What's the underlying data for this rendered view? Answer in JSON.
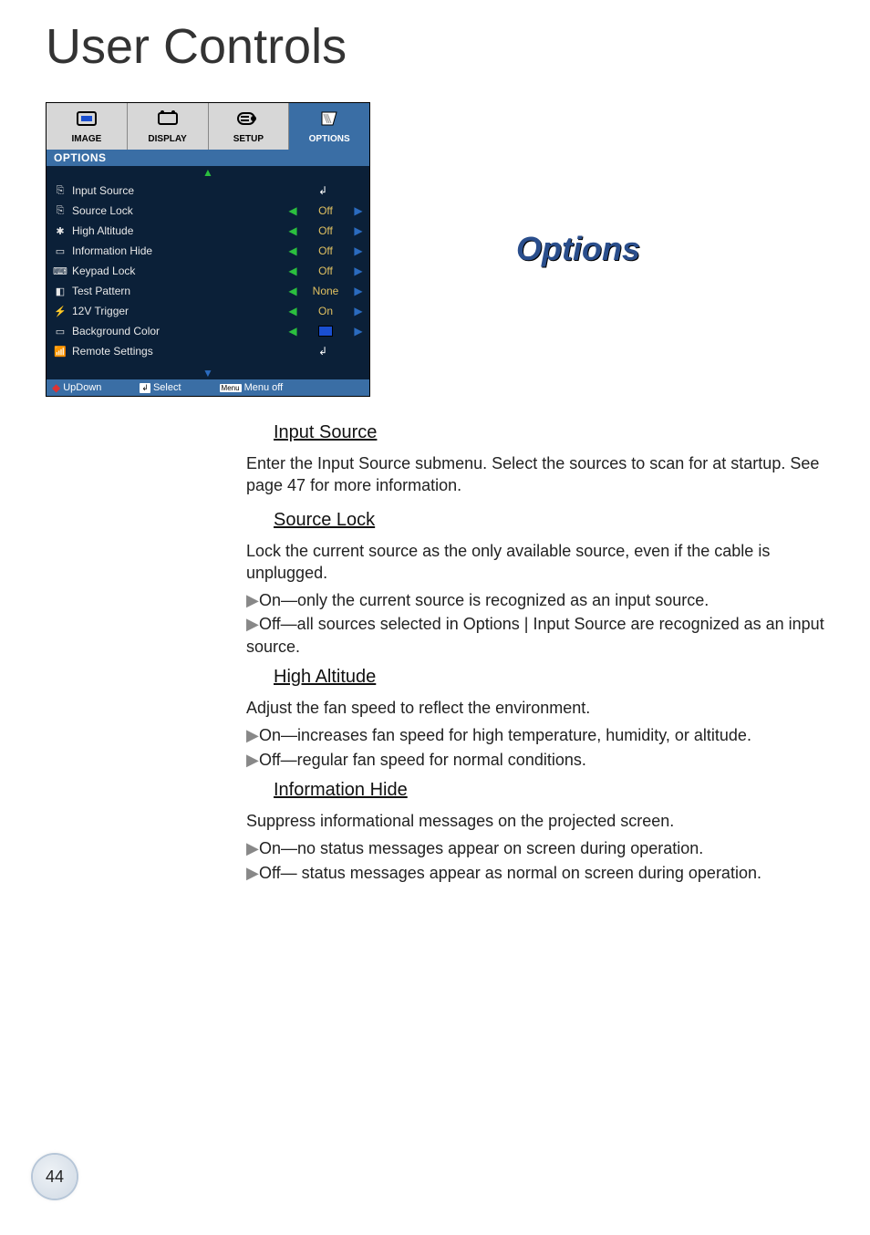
{
  "page_title": "User Controls",
  "section_heading": "Options",
  "osd": {
    "tabs": [
      {
        "label": "IMAGE"
      },
      {
        "label": "DISPLAY"
      },
      {
        "label": "SETUP"
      },
      {
        "label": "OPTIONS"
      }
    ],
    "header": "OPTIONS",
    "items": [
      {
        "label": "Input Source",
        "type": "submenu"
      },
      {
        "label": "Source Lock",
        "type": "toggle",
        "value": "Off"
      },
      {
        "label": "High Altitude",
        "type": "toggle",
        "value": "Off"
      },
      {
        "label": "Information Hide",
        "type": "toggle",
        "value": "Off"
      },
      {
        "label": "Keypad Lock",
        "type": "toggle",
        "value": "Off"
      },
      {
        "label": "Test Pattern",
        "type": "toggle",
        "value": "None"
      },
      {
        "label": "12V Trigger",
        "type": "toggle",
        "value": "On"
      },
      {
        "label": "Background Color",
        "type": "color"
      },
      {
        "label": "Remote Settings",
        "type": "submenu"
      }
    ],
    "footer": {
      "updown": "UpDown",
      "select": "Select",
      "menu_key": "Menu",
      "menuoff": "Menu off"
    }
  },
  "sections": [
    {
      "heading": "Input Source",
      "paras": [
        "Enter the Input Source submenu. Select the sources to scan for at startup. See page 47 for more information."
      ],
      "bullets": []
    },
    {
      "heading": "Source Lock",
      "paras": [
        "Lock the current source as the only available source, even if the cable is unplugged."
      ],
      "bullets": [
        "On—only the current source is recognized as an input source.",
        "Off—all sources selected in Options | Input Source are recognized as an input source."
      ]
    },
    {
      "heading": "High Altitude",
      "paras": [
        "Adjust the fan speed to reflect the environment."
      ],
      "bullets": [
        "On—increases fan speed for high temperature, humidity, or altitude.",
        "Off—regular fan speed for normal conditions."
      ]
    },
    {
      "heading": "Information Hide",
      "paras": [
        "Suppress informational messages on the projected screen."
      ],
      "bullets": [
        "On—no status messages appear on screen during operation.",
        "Off— status messages appear as normal on screen during operation."
      ]
    }
  ],
  "page_number": "44"
}
